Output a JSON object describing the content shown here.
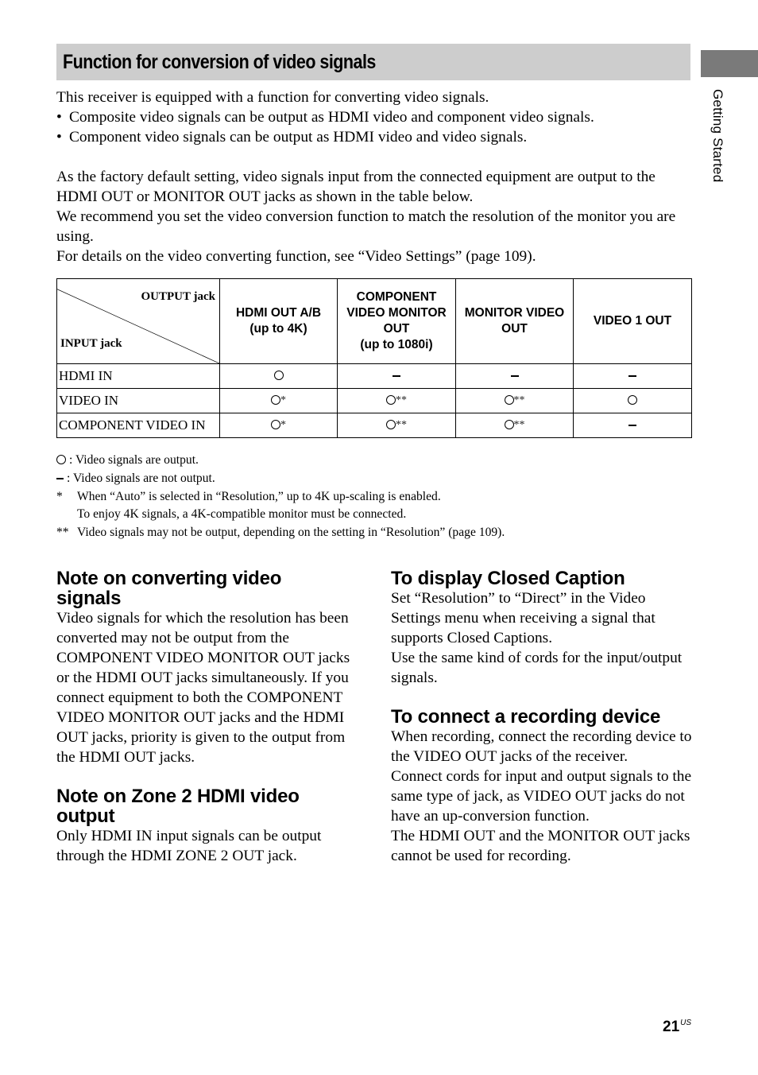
{
  "header": {
    "title": "Function for conversion of video signals",
    "side_tab_label": "Getting Started"
  },
  "intro": {
    "lead": "This receiver is equipped with a function for converting video signals.",
    "bullets": [
      "Composite video signals can be output as HDMI video and component video signals.",
      "Component video signals can be output as HDMI video and video signals."
    ],
    "bullet_char": "•",
    "paragraphs": [
      "As the factory default setting, video signals input from the connected equipment are output to the HDMI OUT or MONITOR OUT jacks as shown in the table below.",
      "We recommend you set the video conversion function to match the resolution of the monitor you are using.",
      "For details on the video converting function, see “Video Settings” (page 109)."
    ]
  },
  "table": {
    "corner_output_label": "OUTPUT jack",
    "corner_input_label": "INPUT jack",
    "columns": [
      {
        "lines": [
          "HDMI OUT A/B",
          "(up to 4K)"
        ]
      },
      {
        "lines": [
          "COMPONENT",
          "VIDEO MONITOR",
          "OUT",
          "(up to 1080i)"
        ]
      },
      {
        "lines": [
          "MONITOR VIDEO",
          "OUT"
        ]
      },
      {
        "lines": [
          "VIDEO 1 OUT"
        ]
      }
    ],
    "rows": [
      {
        "label": "HDMI IN",
        "cells": [
          {
            "output": true,
            "note": ""
          },
          {
            "output": false,
            "note": ""
          },
          {
            "output": false,
            "note": ""
          },
          {
            "output": false,
            "note": ""
          }
        ]
      },
      {
        "label": "VIDEO IN",
        "cells": [
          {
            "output": true,
            "note": "*"
          },
          {
            "output": true,
            "note": "**"
          },
          {
            "output": true,
            "note": "**"
          },
          {
            "output": true,
            "note": ""
          }
        ]
      },
      {
        "label": "COMPONENT VIDEO IN",
        "cells": [
          {
            "output": true,
            "note": "*"
          },
          {
            "output": true,
            "note": "**"
          },
          {
            "output": true,
            "note": "**"
          },
          {
            "output": false,
            "note": ""
          }
        ]
      }
    ]
  },
  "notes": {
    "legend_output": ": Video signals are output.",
    "legend_not_output": ": Video signals are not output.",
    "footnotes": [
      {
        "mark": "*",
        "lines": [
          "When “Auto” is selected in “Resolution,” up to 4K up-scaling is enabled.",
          "To enjoy 4K signals, a 4K-compatible monitor must be connected."
        ]
      },
      {
        "mark": "**",
        "lines": [
          "Video signals may not be output, depending on the setting in “Resolution” (page 109)."
        ]
      }
    ]
  },
  "sections": {
    "converting": {
      "heading_lines": [
        "Note on converting video",
        "signals"
      ],
      "body": "Video signals for which the resolution has been converted may not be output from the COMPONENT VIDEO MONITOR OUT jacks or the HDMI OUT jacks simultaneously. If you connect equipment to both the COMPONENT VIDEO MONITOR OUT jacks and the HDMI OUT jacks, priority is given to the output from the HDMI OUT jacks."
    },
    "zone2": {
      "heading_lines": [
        "Note on Zone 2 HDMI video",
        "output"
      ],
      "body": "Only HDMI IN input signals can be output through the HDMI ZONE 2 OUT jack."
    },
    "closed_caption": {
      "heading_lines": [
        "To display Closed Caption"
      ],
      "body": "Set “Resolution” to “Direct” in the Video Settings menu when receiving a signal that supports Closed Captions.",
      "body2": "Use the same kind of cords for the input/output signals."
    },
    "recording": {
      "heading_lines": [
        "To connect a recording device"
      ],
      "body": "When recording, connect the recording device to the VIDEO OUT jacks of the receiver.",
      "body2": "Connect cords for input and output signals to the same type of jack, as VIDEO OUT jacks do not have an up-conversion function.",
      "body3": "The HDMI OUT and the MONITOR OUT jacks cannot be used for recording."
    }
  },
  "footer": {
    "page_number": "21",
    "page_suffix": "US"
  }
}
